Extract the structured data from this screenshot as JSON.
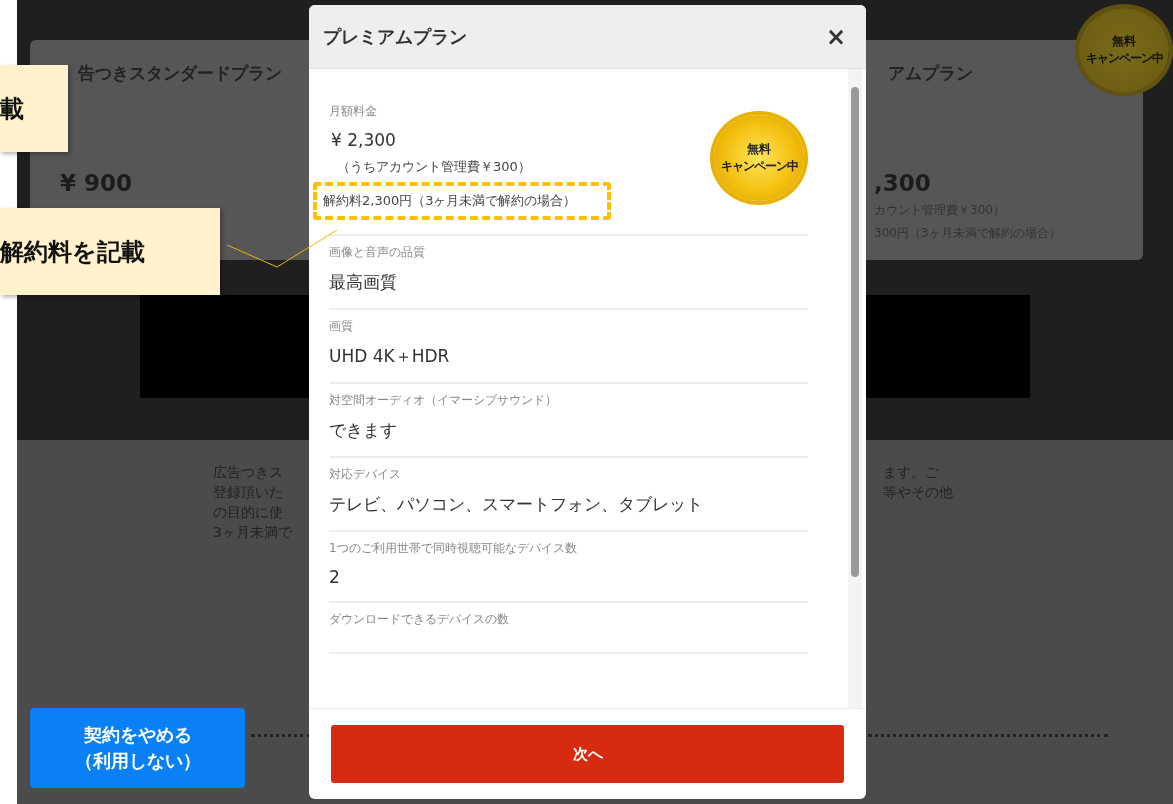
{
  "background_page": {
    "left_plan": {
      "title": "告つきスタンダードプラン",
      "price": "¥ 900"
    },
    "right_plan": {
      "title": "アムプラン",
      "price": ",300",
      "notes": [
        "カウント管理費￥300）",
        "300円（3ヶ月未満で解約の場合）"
      ],
      "badge": [
        "無料",
        "キャンペーン中"
      ]
    },
    "description_left": [
      "広告つきス",
      "登録頂いた",
      "の目的に使",
      "3ヶ月未満で"
    ],
    "description_right": [
      "ます。ご",
      "等やその他"
    ],
    "cancel_button": [
      "契約をやめる",
      "（利用しない）"
    ]
  },
  "modal": {
    "title": "プレミアムプラン",
    "close": "×",
    "badge": [
      "無料",
      "キャンペーン中"
    ],
    "sections": [
      {
        "label": "月額料金",
        "value": "¥ 2,300",
        "notes": [
          {
            "text": "（うちアカウント管理費￥300）",
            "highlighted": false
          },
          {
            "text": "解約料2,300円（3ヶ月未満で解約の場合）",
            "highlighted": true
          }
        ]
      },
      {
        "label": "画像と音声の品質",
        "value": "最高画質"
      },
      {
        "label": "画質",
        "value": "UHD 4K＋HDR"
      },
      {
        "label": "対空間オーディオ（イマーシブサウンド）",
        "value": "できます"
      },
      {
        "label": "対応デバイス",
        "value": "テレビ、パソコン、スマートフォン、タブレット"
      },
      {
        "label": "1つのご利用世帯で同時視聴可能なデバイス数",
        "value": "2"
      },
      {
        "label": "ダウンロードできるデバイスの数"
      }
    ],
    "next_button": "次へ"
  },
  "callouts": [
    {
      "text": "載"
    },
    {
      "text": "解約料を記載"
    }
  ]
}
